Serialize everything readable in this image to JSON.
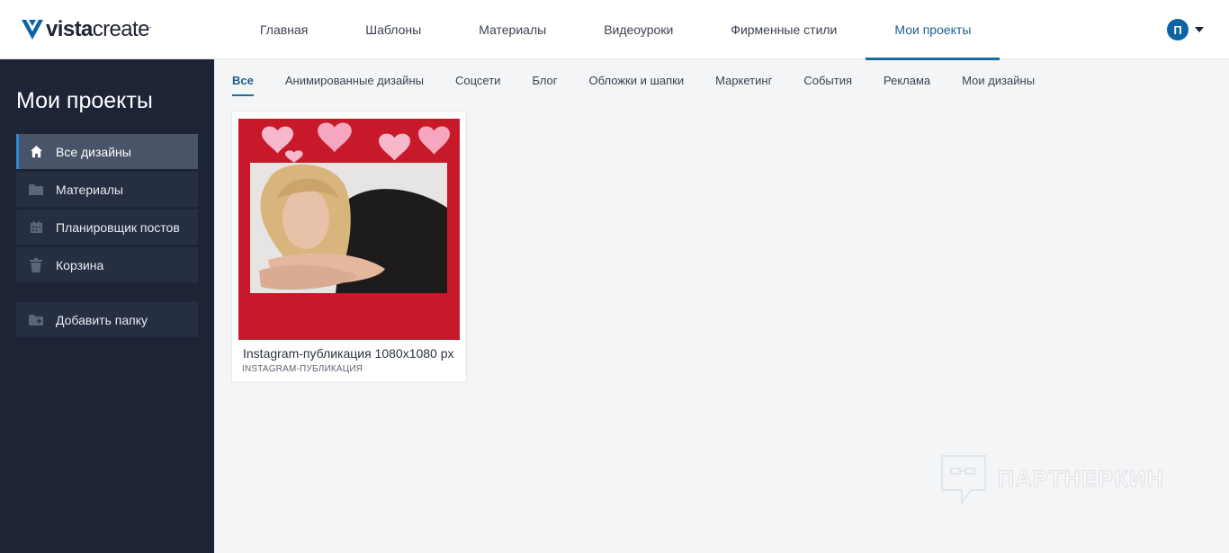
{
  "brand": {
    "logo_bold": "vista",
    "logo_light": "create",
    "logo_dot": ".",
    "mark_color": "#0c63a6"
  },
  "header": {
    "nav": [
      {
        "label": "Главная"
      },
      {
        "label": "Шаблоны"
      },
      {
        "label": "Материалы"
      },
      {
        "label": "Видеоуроки"
      },
      {
        "label": "Фирменные стили"
      },
      {
        "label": "Мои проекты",
        "active": true
      }
    ],
    "user_initial": "П",
    "accent": "#1c6c9e"
  },
  "sidebar": {
    "title": "Мои проекты",
    "items": [
      {
        "label": "Все дизайны",
        "icon": "home-icon",
        "active": true
      },
      {
        "label": "Материалы",
        "icon": "folder-icon"
      },
      {
        "label": "Планировщик постов",
        "icon": "calendar-icon"
      },
      {
        "label": "Корзина",
        "icon": "trash-icon"
      },
      {
        "label": "Добавить папку",
        "icon": "add-folder-icon"
      }
    ]
  },
  "filters": [
    {
      "label": "Все",
      "active": true
    },
    {
      "label": "Анимированные дизайны"
    },
    {
      "label": "Соцсети"
    },
    {
      "label": "Блог"
    },
    {
      "label": "Обложки и шапки"
    },
    {
      "label": "Маркетинг"
    },
    {
      "label": "События"
    },
    {
      "label": "Реклама"
    },
    {
      "label": "Мои дизайны"
    }
  ],
  "projects": [
    {
      "title": "Instagram-публикация 1080x1080 px",
      "type": "INSTAGRAM-ПУБЛИКАЦИЯ",
      "background_color": "#c8192a"
    }
  ],
  "watermark": {
    "text": "ПАРТНЕРКИН"
  }
}
